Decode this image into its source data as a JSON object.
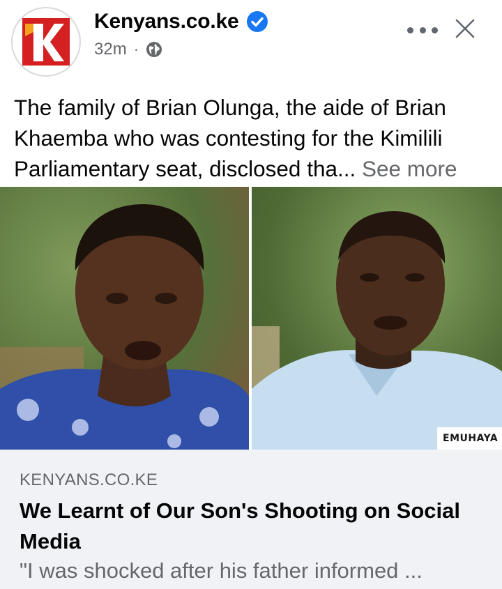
{
  "post": {
    "page_name": "Kenyans.co.ke",
    "timestamp": "32m",
    "separator": "·",
    "audience_icon": "globe-icon",
    "verified_icon": "verified-badge-icon",
    "text": "The family of Brian Olunga, the aide of Brian Khaemba who was contesting for the Kimilili Parliamentary seat, disclosed tha...",
    "see_more": "See more"
  },
  "image": {
    "watermark": "EMUHAYA"
  },
  "link_preview": {
    "source": "KENYANS.CO.KE",
    "headline": "We Learnt of Our Son's Shooting on Social Media",
    "snippet": "\"I was shocked after his father informed ..."
  },
  "colors": {
    "brand_red": "#d42020",
    "verified_blue": "#1877f2",
    "secondary_text": "#65676b",
    "preview_bg": "#f0f2f5"
  }
}
